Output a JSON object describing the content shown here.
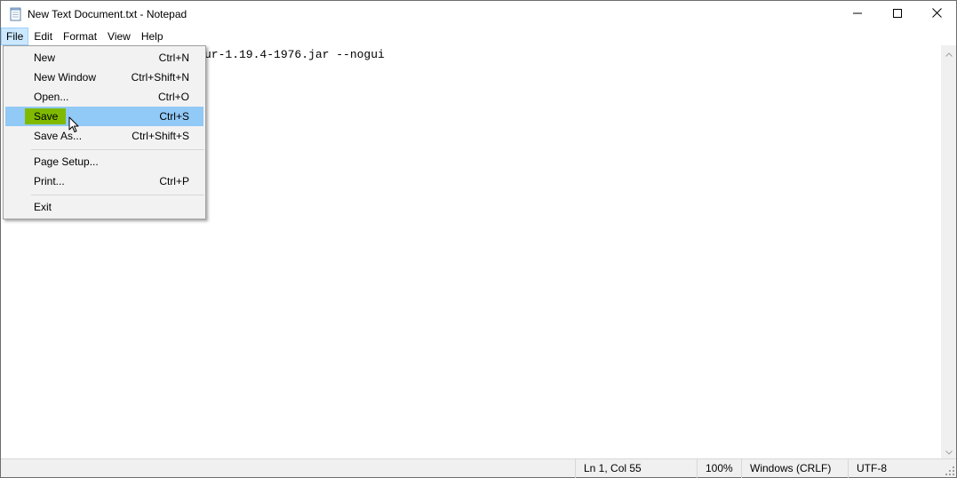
{
  "window": {
    "title": "New Text Document.txt - Notepad",
    "icon": "notepad-icon",
    "controls": [
      "minimize-icon",
      "maximize-icon",
      "close-icon"
    ]
  },
  "menubar": {
    "items": [
      {
        "label": "File",
        "active": true
      },
      {
        "label": "Edit"
      },
      {
        "label": "Format"
      },
      {
        "label": "View"
      },
      {
        "label": "Help"
      }
    ]
  },
  "editor": {
    "visible_text": "ur-1.19.4-1976.jar --nogui"
  },
  "file_menu": {
    "items": [
      {
        "label": "New",
        "shortcut": "Ctrl+N"
      },
      {
        "label": "New Window",
        "shortcut": "Ctrl+Shift+N"
      },
      {
        "label": "Open...",
        "shortcut": "Ctrl+O"
      },
      {
        "label": "Save",
        "shortcut": "Ctrl+S",
        "hovered": true
      },
      {
        "label": "Save As...",
        "shortcut": "Ctrl+Shift+S"
      },
      {
        "label": "Page Setup...",
        "shortcut": ""
      },
      {
        "label": "Print...",
        "shortcut": "Ctrl+P"
      },
      {
        "label": "Exit",
        "shortcut": ""
      }
    ]
  },
  "statusbar": {
    "position": "Ln 1, Col 55",
    "zoom": "100%",
    "line_ending": "Windows (CRLF)",
    "encoding": "UTF-8"
  },
  "colors": {
    "menu_hover": "#91c9f7",
    "save_highlight": "#7fba00",
    "menubar_active": "#cce8ff"
  }
}
